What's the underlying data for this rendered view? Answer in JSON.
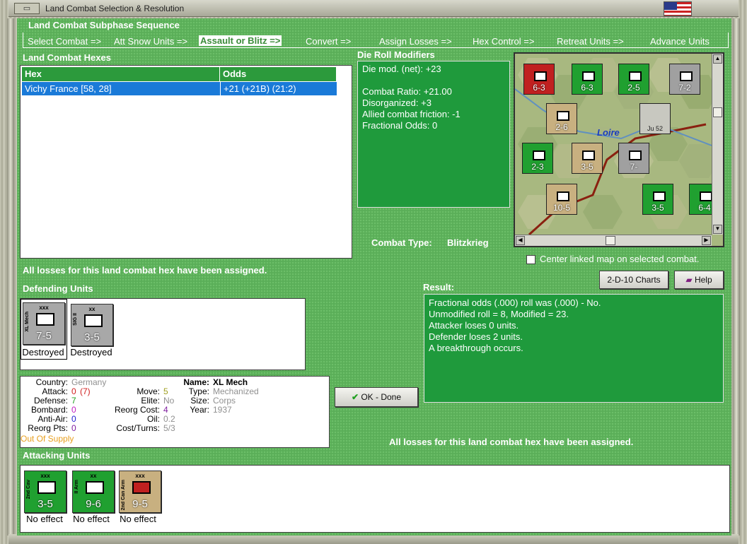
{
  "window": {
    "title": "Land Combat Selection & Resolution",
    "sys_button": "▭"
  },
  "sequence": {
    "header": "Land Combat Subphase Sequence",
    "steps": [
      "Select Combat =>",
      "Att Snow Units =>",
      "Assault or Blitz =>",
      "Convert =>",
      "Assign Losses =>",
      "Hex Control =>",
      "Retreat Units =>",
      "Advance Units"
    ],
    "active_index": 2
  },
  "hexes": {
    "header": "Land Combat Hexes",
    "columns": [
      "Hex",
      "Odds"
    ],
    "rows": [
      {
        "hex": "Vichy France [58, 28]",
        "odds": "+21 (+21B) (21:2)"
      }
    ]
  },
  "modifiers": {
    "header": "Die Roll Modifiers",
    "lines": [
      "Die mod. (net): +23",
      "",
      "Combat Ratio: +21.00",
      "Disorganized: +3",
      "Allied combat friction: -1",
      "Fractional Odds: 0"
    ]
  },
  "combat_type": {
    "label": "Combat Type:",
    "value": "Blitzkrieg"
  },
  "map": {
    "river": "Loire",
    "center_checkbox": "Center linked map on selected combat.",
    "counters": [
      {
        "value": "6-3",
        "color": "#c02020"
      },
      {
        "value": "6-3",
        "color": "#20a030"
      },
      {
        "value": "2-5",
        "color": "#20a030"
      },
      {
        "value": "7-2",
        "color": "#a0a0a0"
      },
      {
        "value": "2-6",
        "color": "#c8b080"
      },
      {
        "value": "Ju 52",
        "color": "#c8c8c0"
      },
      {
        "value": "2-3",
        "color": "#20a030"
      },
      {
        "value": "3-5",
        "color": "#c8b080"
      },
      {
        "value": "7-",
        "color": "#a0a0a0"
      },
      {
        "value": "10-5",
        "color": "#c8b080"
      },
      {
        "value": "3-5",
        "color": "#20a030"
      },
      {
        "value": "6-4",
        "color": "#20a030"
      }
    ]
  },
  "losses_msg": "All losses for this land combat hex have been assigned.",
  "defending": {
    "header": "Defending Units",
    "units": [
      {
        "size": "xxx",
        "name": "XL Mech",
        "value": "7-5",
        "status": "Destroyed",
        "color": "#a8a8a8"
      },
      {
        "size": "xx",
        "name": "SIG II",
        "value": "3-5",
        "status": "Destroyed",
        "color": "#a8a8a8"
      }
    ]
  },
  "result": {
    "header": "Result:",
    "lines": [
      "Fractional odds (.000) roll was (.000)  - No.",
      "Unmodified roll = 8, Modified = 23.",
      "Attacker loses 0 units.",
      "Defender loses 2 units.",
      "A breakthrough occurs."
    ]
  },
  "buttons": {
    "charts": "2-D-10 Charts",
    "help": "Help",
    "ok": "OK - Done"
  },
  "details": {
    "country_label": "Country:",
    "country": "Germany",
    "attack_label": "Attack:",
    "attack": "0",
    "attack_extra": "(7)",
    "defense_label": "Defense:",
    "defense": "7",
    "bombard_label": "Bombard:",
    "bombard": "0",
    "antiair_label": "Anti-Air:",
    "antiair": "0",
    "reorgpts_label": "Reorg Pts:",
    "reorgpts": "0",
    "supply": "Out Of Supply",
    "move_label": "Move:",
    "move": "5",
    "elite_label": "Elite:",
    "elite": "No",
    "reorgcost_label": "Reorg Cost:",
    "reorgcost": "4",
    "oil_label": "Oil:",
    "oil": "0.2",
    "cost_label": "Cost/Turns:",
    "cost": "5/3",
    "name_label": "Name:",
    "name": "XL Mech",
    "type_label": "Type:",
    "type": "Mechanized",
    "size_label": "Size:",
    "size": "Corps",
    "year_label": "Year:",
    "year": "1937"
  },
  "attacking": {
    "header": "Attacking Units",
    "units": [
      {
        "size": "xxx",
        "name": "2nd Cav",
        "value": "3-5",
        "status": "No effect",
        "color": "#20a030"
      },
      {
        "size": "xx",
        "name": "II Arm",
        "value": "9-6",
        "status": "No effect",
        "color": "#20a030"
      },
      {
        "size": "xxx",
        "name": "2nd Can Arm",
        "value": "9-5",
        "status": "No effect",
        "color": "#c8b080"
      }
    ]
  },
  "colors": {
    "panel_green": "#5aae58",
    "dark_green": "#1f9a3c",
    "select_blue": "#1a7ad8",
    "supply_orange": "#e8a020"
  }
}
